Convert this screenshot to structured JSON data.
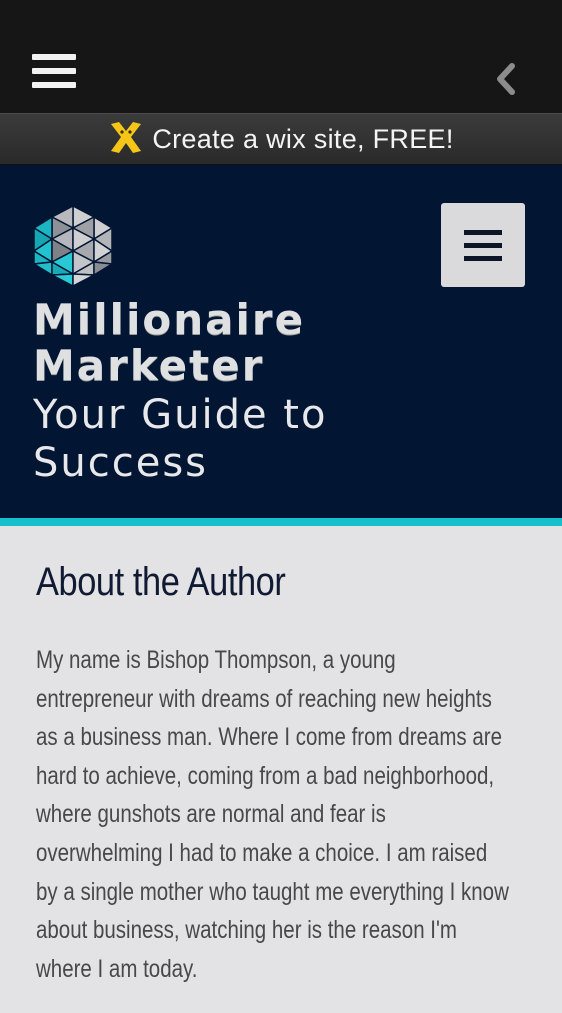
{
  "topbar": {
    "menu_icon": "hamburger-menu-icon",
    "back_icon": "chevron-left-icon"
  },
  "wix_banner": {
    "icon": "wix-logo-icon",
    "text": "Create a wix site, FREE!"
  },
  "header": {
    "logo_icon": "hexagon-grid-logo-icon",
    "title_line1": "Millionaire",
    "title_line2": "Marketer",
    "tagline_line1": "Your Guide to",
    "tagline_line2": "Success",
    "menu_button_icon": "hamburger-menu-icon",
    "colors": {
      "background": "#021633",
      "accent": "#15c0cc"
    }
  },
  "about": {
    "heading": "About the Author",
    "body": "My name is Bishop Thompson, a young entrepreneur with dreams of reaching new heights as a business man. Where I come from dreams are hard to achieve, coming from a bad neighborhood, where gunshots are normal and fear is overwhelming I had to make a choice. I am raised by a single mother who taught me everything I know about business, watching her is the reason I'm where I am today."
  }
}
